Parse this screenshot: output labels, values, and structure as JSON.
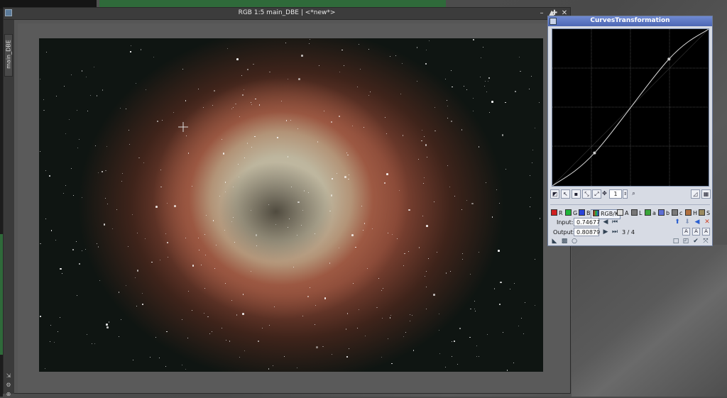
{
  "image_window": {
    "title": "RGB 1:5 main_DBE | <*new*>",
    "side_tab_label": "main_DBE",
    "controls": [
      "–",
      "▲",
      "✚",
      "✕"
    ]
  },
  "curves": {
    "title": "CurvesTransformation",
    "zoom_value": "1",
    "channels": [
      {
        "key": "R",
        "label": "R",
        "color": "#d01f1f"
      },
      {
        "key": "G",
        "label": "G",
        "color": "#1fb43a"
      },
      {
        "key": "B",
        "label": "B",
        "color": "#2a44d8"
      },
      {
        "key": "RGBK",
        "label": "RGB/K",
        "color": "#666666"
      },
      {
        "key": "A",
        "label": "A",
        "color": "#dddddd"
      },
      {
        "key": "L",
        "label": "L",
        "color": "#777777"
      },
      {
        "key": "a",
        "label": "a",
        "color": "#3aa53a"
      },
      {
        "key": "b",
        "label": "b",
        "color": "#5e6fd4"
      },
      {
        "key": "c",
        "label": "c",
        "color": "#7a7a7a"
      },
      {
        "key": "H",
        "label": "H",
        "color": "#b07040"
      },
      {
        "key": "S",
        "label": "S",
        "color": "#9a8a60"
      }
    ],
    "input_label": "Input:",
    "input_value": "0.74677",
    "output_label": "Output:",
    "output_value": "0.80879",
    "point_counter": "3 / 4",
    "curve_points": [
      [
        0,
        0
      ],
      [
        0.27,
        0.21
      ],
      [
        0.74677,
        0.80879
      ],
      [
        1,
        1
      ]
    ]
  }
}
